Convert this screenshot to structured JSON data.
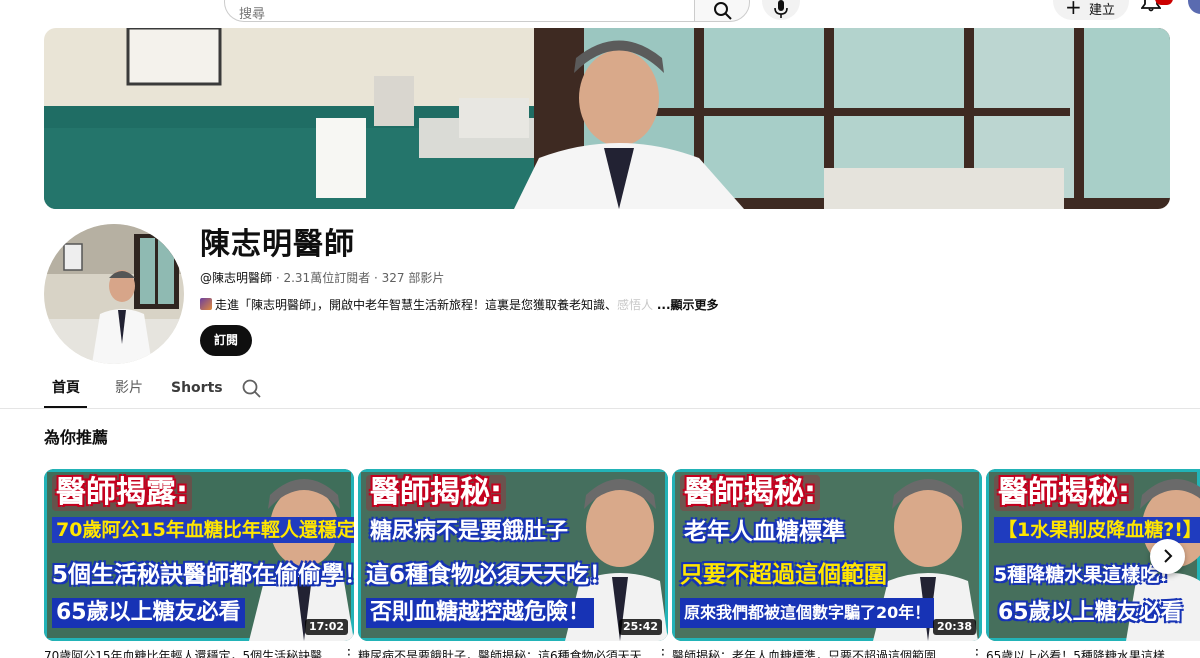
{
  "search": {
    "placeholder": "搜尋"
  },
  "header": {
    "create_label": "建立"
  },
  "channel": {
    "name": "陳志明醫師",
    "handle": "@陳志明醫師",
    "subscribers": "2.31萬位訂閱者",
    "videos": "327 部影片",
    "description_visible": "走進「陳志明醫師」，開啟中老年智慧生活新旅程！這裏是您獲取養老知識、",
    "description_faded": "感悟人",
    "show_more": "...顯示更多",
    "subscribe_label": "訂閱"
  },
  "tabs": [
    {
      "label": "首頁",
      "active": true
    },
    {
      "label": "影片",
      "active": false
    },
    {
      "label": "Shorts",
      "active": false
    }
  ],
  "section": {
    "title": "為你推薦"
  },
  "videos": [
    {
      "heading": "醫師揭露:",
      "line1": "70歲阿公15年血糖比年輕人還穩定",
      "line2": "5個生活秘訣醫師都在偷偷學！",
      "line3": "65歲以上糖友必看",
      "duration": "17:02",
      "title": "70歲阿公15年血糖比年輕人還穩定，5個生活秘訣醫"
    },
    {
      "heading": "醫師揭秘:",
      "line1": "糖尿病不是要餓肚子",
      "line2": "這6種食物必須天天吃！",
      "line3": "否則血糖越控越危險！",
      "duration": "25:42",
      "title": "糖尿病不是要餓肚子，醫師揭秘：這6種食物必須天天"
    },
    {
      "heading": "醫師揭秘:",
      "line1": "老年人血糖標準",
      "line2": "只要不超過這個範圍",
      "line3": "原來我們都被這個數字騙了20年！",
      "duration": "20:38",
      "title": "醫師揭秘：老年人血糖標準，只要不超過這個範圍"
    },
    {
      "heading": "醫師揭秘:",
      "line1": "【1水果削皮降血糖?!】",
      "line2": "5種降糖水果這樣吃!",
      "line3": "65歲以上糖友必看",
      "duration": "",
      "title": "65歲以上必看！5種降糖水果這樣"
    }
  ],
  "colors": {
    "subscribe_bg": "#0f0f0f",
    "thumb_red": "#c4001e",
    "thumb_blue": "#1733b5",
    "thumb_yellow": "#ffe600",
    "badge_red": "#cc0000"
  }
}
